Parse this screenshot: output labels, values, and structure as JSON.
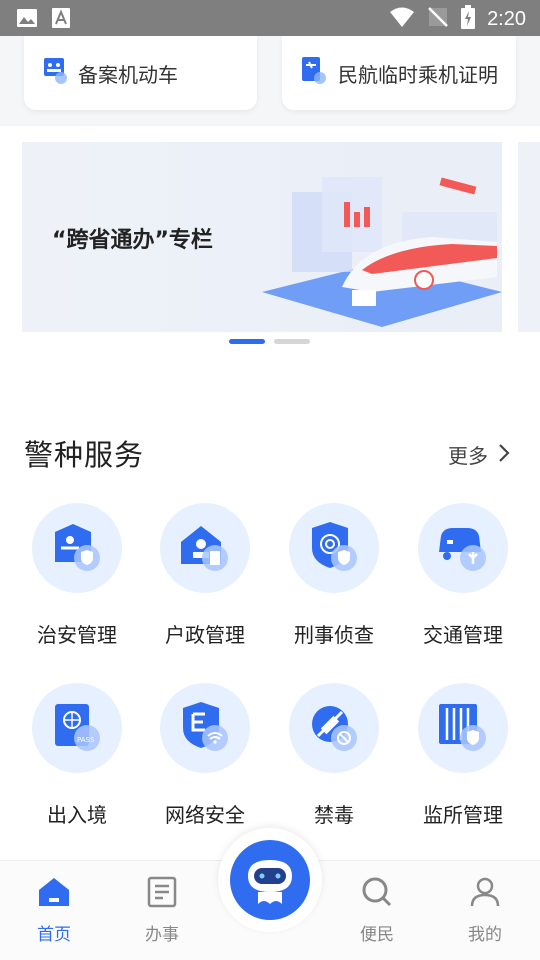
{
  "status_bar": {
    "time": "2:20"
  },
  "quick_cards": [
    {
      "label": "备案机动车",
      "icon": "vehicle-registration-icon"
    },
    {
      "label": "民航临时乘机证明",
      "icon": "boarding-certificate-icon"
    }
  ],
  "banner": {
    "title": "“跨省通办”专栏",
    "pages": 2,
    "active_page": 1
  },
  "section": {
    "title": "警种服务",
    "more_label": "更多"
  },
  "services": [
    {
      "label": "治安管理",
      "icon": "public-security-icon"
    },
    {
      "label": "户政管理",
      "icon": "household-registration-icon"
    },
    {
      "label": "刑事侦查",
      "icon": "criminal-investigation-icon"
    },
    {
      "label": "交通管理",
      "icon": "traffic-management-icon"
    },
    {
      "label": "出入境",
      "icon": "passport-icon"
    },
    {
      "label": "网络安全",
      "icon": "cyber-security-icon"
    },
    {
      "label": "禁毒",
      "icon": "anti-drug-icon"
    },
    {
      "label": "监所管理",
      "icon": "detention-management-icon"
    }
  ],
  "tabs": [
    {
      "label": "首页",
      "icon": "home-icon",
      "active": true
    },
    {
      "label": "办事",
      "icon": "document-icon",
      "active": false
    },
    {
      "label": "便民",
      "icon": "search-icon",
      "active": false
    },
    {
      "label": "我的",
      "icon": "profile-icon",
      "active": false
    }
  ],
  "colors": {
    "accent": "#2f6cf0",
    "icon_bg": "#e7f0ff",
    "status_bar": "#7f7f7f"
  }
}
